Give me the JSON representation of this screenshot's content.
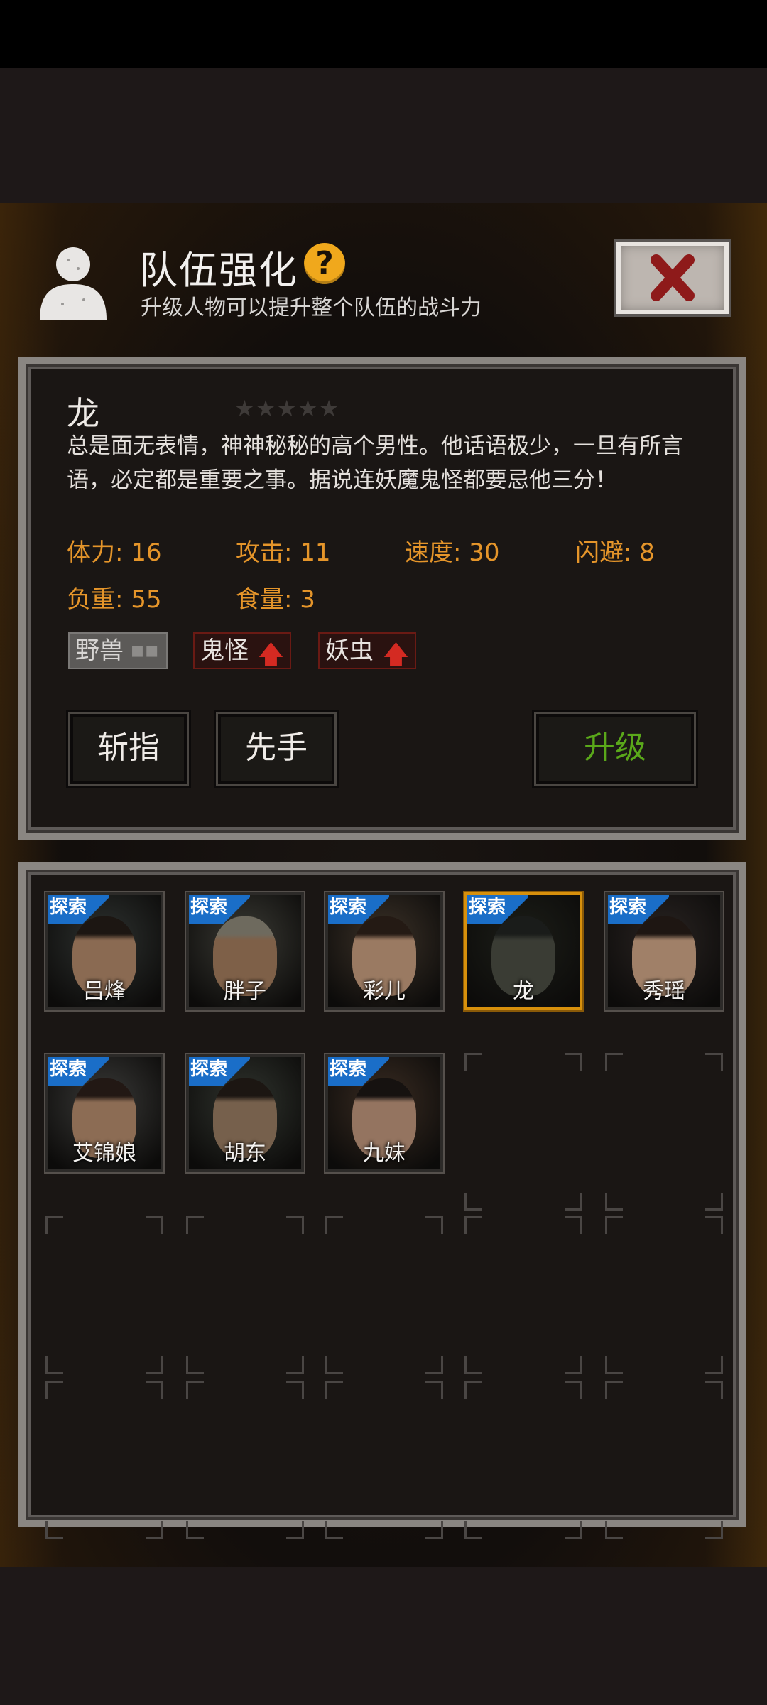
{
  "header": {
    "title": "队伍强化",
    "help": "?",
    "subtitle": "升级人物可以提升整个队伍的战斗力"
  },
  "character": {
    "name": "龙",
    "stars": "★★★★★",
    "description": "总是面无表情，神神秘秘的高个男性。他话语极少，一旦有所言语，必定都是重要之事。据说连妖魔鬼怪都要忌他三分！",
    "stats": {
      "hp": "体力: 16",
      "attack": "攻击: 11",
      "speed": "速度: 30",
      "dodge": "闪避: 8",
      "load": "负重: 55",
      "food": "食量: 3"
    },
    "tags": [
      {
        "label": "野兽",
        "marker": "▪▪"
      },
      {
        "label": "鬼怪",
        "marker": "🡅"
      },
      {
        "label": "妖虫",
        "marker": "🡅"
      }
    ]
  },
  "actions": {
    "skill1": "斩指",
    "skill2": "先手",
    "upgrade": "升级"
  },
  "roster": {
    "badge": "探索",
    "members": [
      {
        "name": "吕烽"
      },
      {
        "name": "胖子"
      },
      {
        "name": "彩儿"
      },
      {
        "name": "龙"
      },
      {
        "name": "秀瑶"
      },
      {
        "name": "艾锦娘"
      },
      {
        "name": "胡东"
      },
      {
        "name": "九妹"
      }
    ]
  },
  "colors": {
    "stat": "#e5952a",
    "upgrade": "#5aa81a",
    "selected_border": "#d7900c",
    "badge": "#1a6ec8",
    "help": "#f0a81c",
    "up_arrow": "#d42a22"
  }
}
